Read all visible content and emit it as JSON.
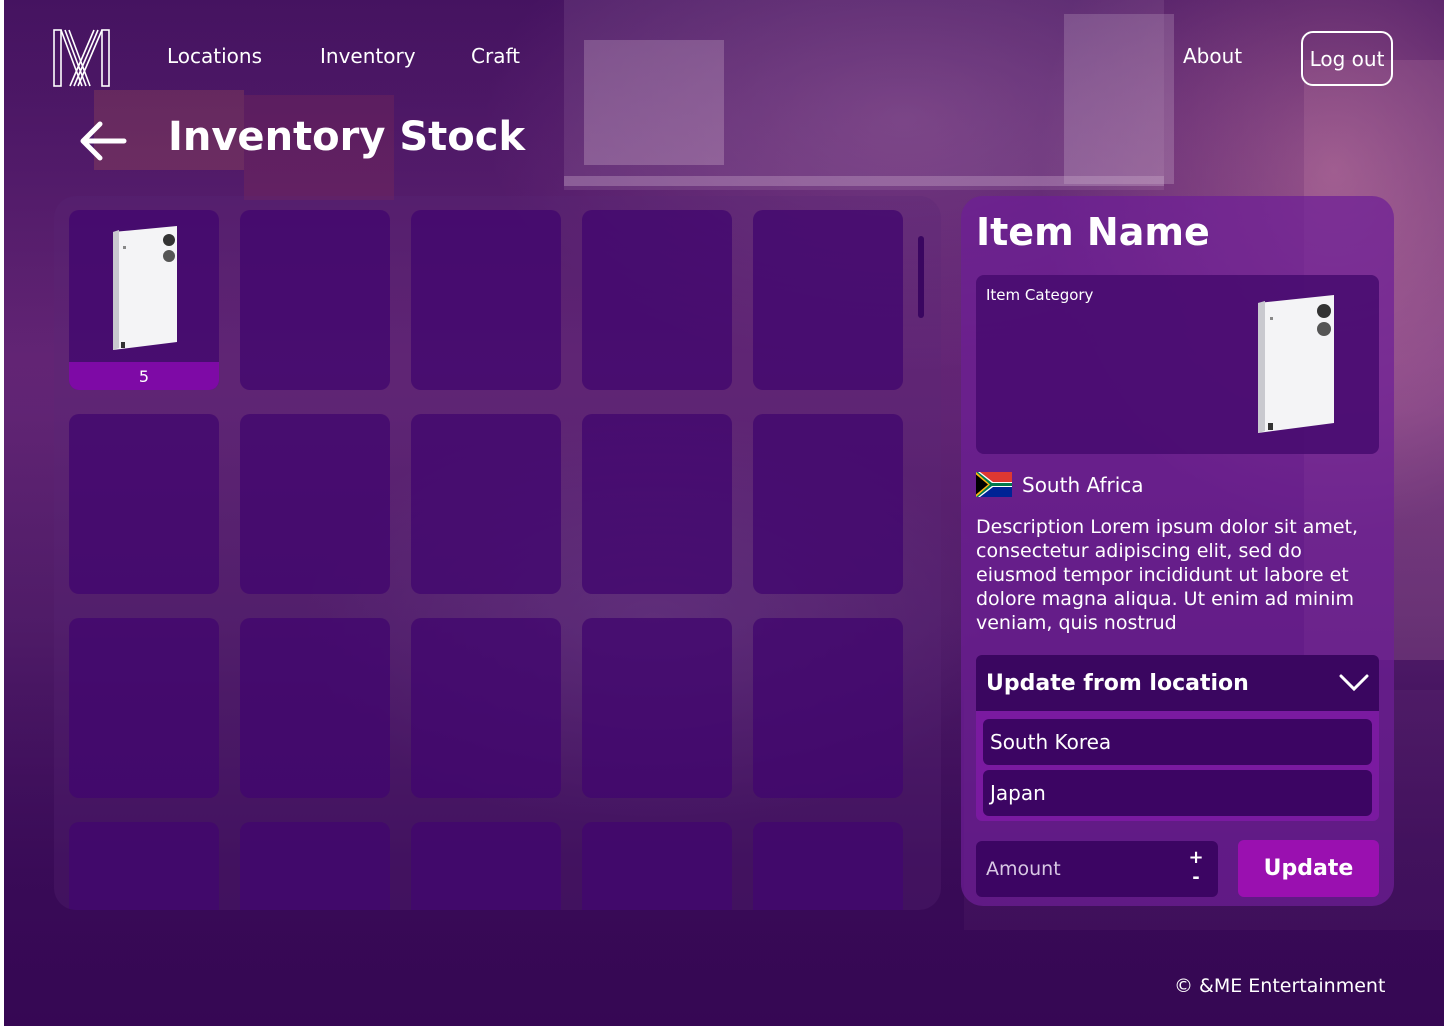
{
  "nav": {
    "links": [
      "Locations",
      "Inventory",
      "Craft"
    ],
    "about": "About",
    "logout": "Log out"
  },
  "page": {
    "title": "Inventory Stock"
  },
  "grid": {
    "tiles": [
      {
        "has_item": true,
        "count": "5"
      }
    ],
    "total_tiles": 20
  },
  "detail": {
    "item_name": "Item Name",
    "item_category": "Item Category",
    "country": "South Africa",
    "description": "Description Lorem ipsum dolor sit amet, consectetur adipiscing elit, sed do eiusmod tempor incididunt ut labore et dolore magna aliqua. Ut enim ad minim veniam, quis nostrud",
    "dropdown_label": "Update from location",
    "options": [
      "South Korea",
      "Japan"
    ],
    "amount_placeholder": "Amount",
    "stepper_plus": "+",
    "stepper_minus": "-",
    "update_label": "Update"
  },
  "footer": {
    "copyright": "© &ME Entertainment"
  },
  "colors": {
    "tile": "#41066e",
    "count_bar": "#7e0aa6",
    "dropdown": "#3a0660",
    "update_button": "#9a10b0"
  }
}
